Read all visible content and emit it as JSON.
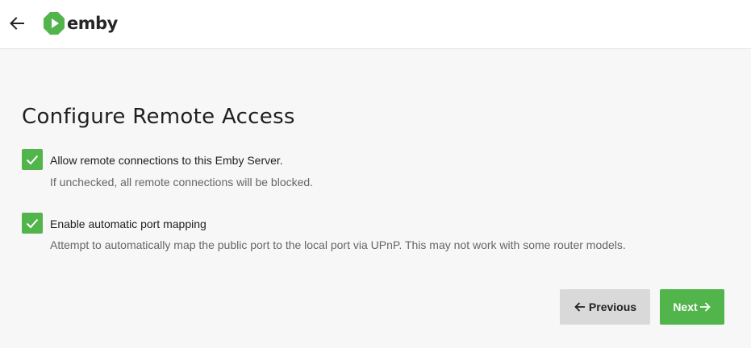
{
  "header": {
    "back_icon": "arrow-left-icon",
    "logo_icon": "emby-logo-icon",
    "logo_text": "emby"
  },
  "main": {
    "title": "Configure Remote Access",
    "options": [
      {
        "label": "Allow remote connections to this Emby Server.",
        "description": "If unchecked, all remote connections will be blocked.",
        "checked": true
      },
      {
        "label": "Enable automatic port mapping",
        "description": "Attempt to automatically map the public port to the local port via UPnP. This may not work with some router models.",
        "checked": true
      }
    ]
  },
  "buttons": {
    "previous_label": "Previous",
    "next_label": "Next"
  },
  "colors": {
    "accent": "#52b54b",
    "secondary_button": "#d9d9d9",
    "background": "#f7f7f7"
  }
}
